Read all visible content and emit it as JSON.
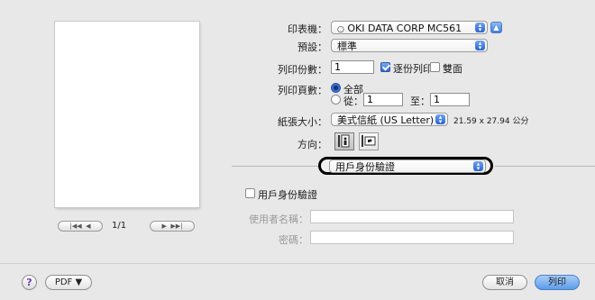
{
  "printer": {
    "label": "印表機：",
    "value": "OKI DATA CORP MC561"
  },
  "presets": {
    "label": "預設：",
    "value": "標準"
  },
  "copies": {
    "label": "列印份數：",
    "value": "1",
    "collated_label": "逐份列印",
    "collated_checked": true,
    "two_sided_label": "雙面",
    "two_sided_checked": false
  },
  "pages": {
    "label": "列印頁數：",
    "all_label": "全部",
    "from_label": "從：",
    "from_value": "1",
    "to_label": "至：",
    "to_value": "1"
  },
  "paper": {
    "label": "紙張大小：",
    "value": "美式信紙 (US Letter)",
    "dimensions": "21.59 x 27.94 公分"
  },
  "orientation": {
    "label": "方向："
  },
  "section": {
    "value": "用戶身份驗證"
  },
  "auth": {
    "checkbox_label": "用戶身份驗證",
    "checked": false,
    "username_label": "使用者名稱：",
    "password_label": "密碼："
  },
  "preview_nav": {
    "page_indicator": "1/1"
  },
  "bottom": {
    "help": "?",
    "pdf_label": "PDF ▼",
    "cancel_label": "取消",
    "print_label": "列印"
  }
}
